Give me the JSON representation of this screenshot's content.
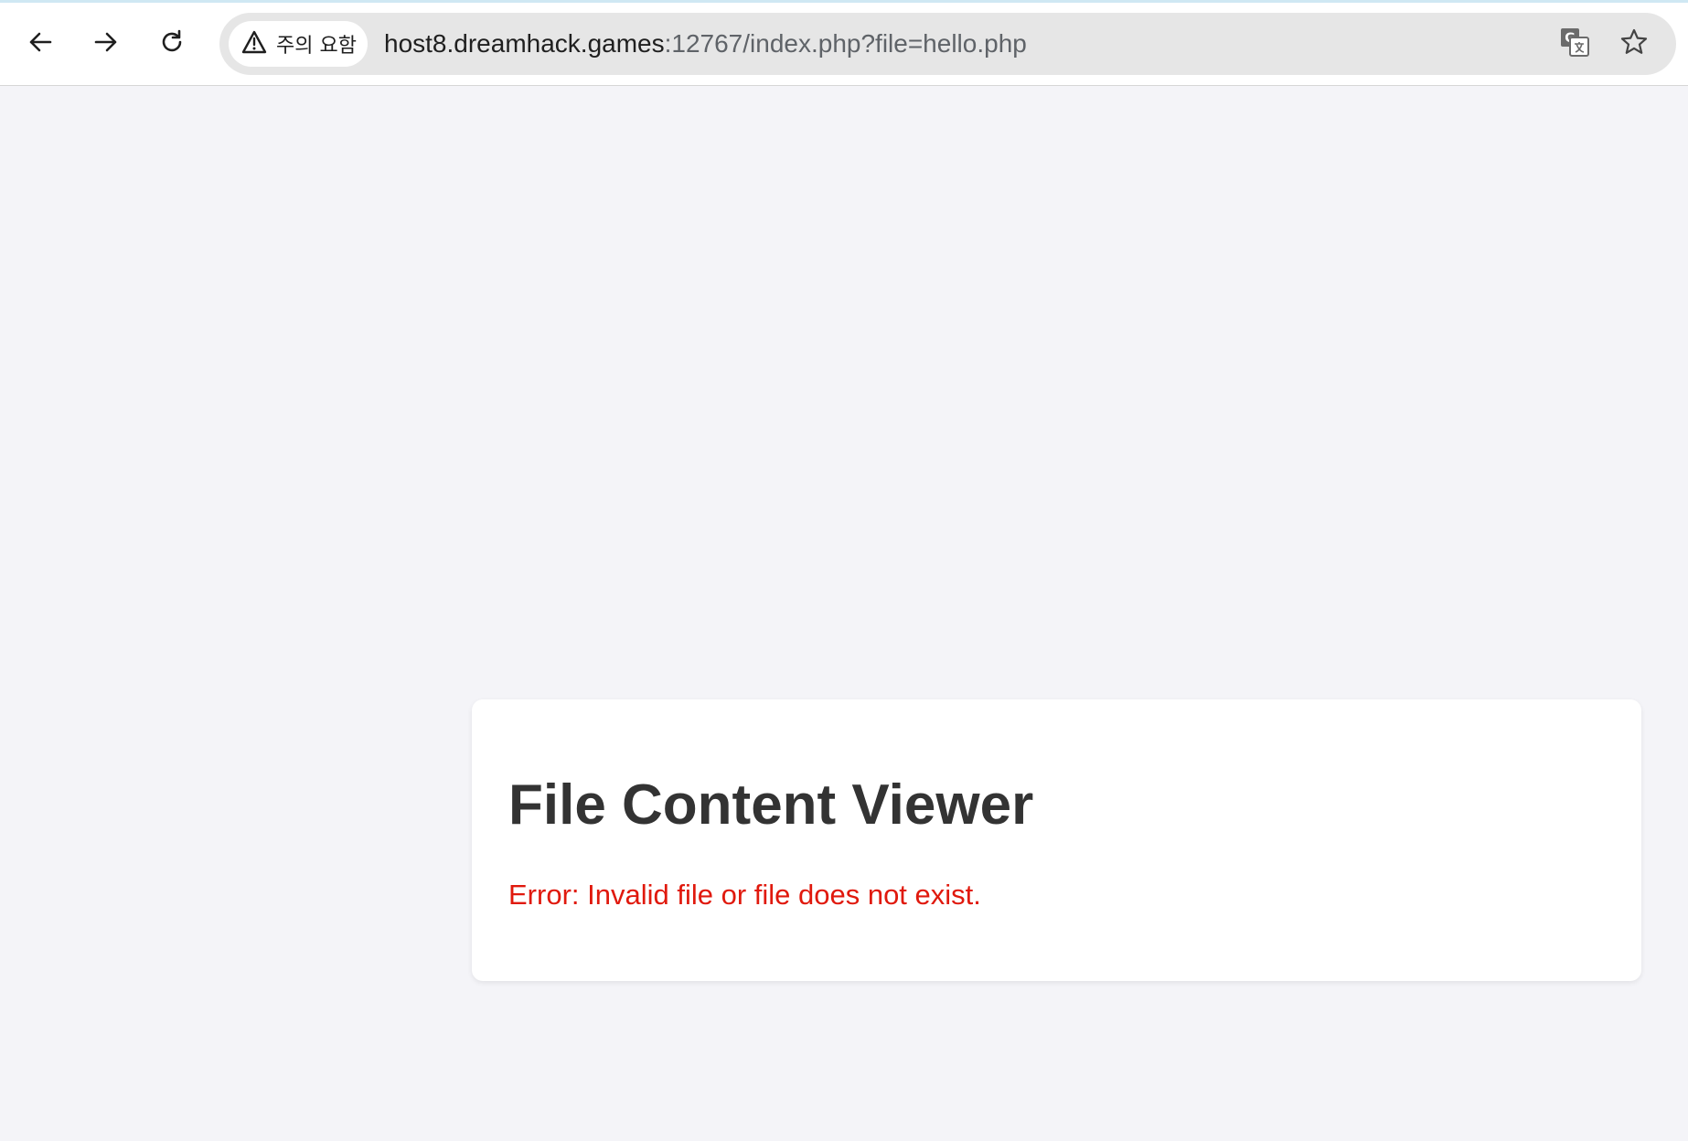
{
  "browser": {
    "security_chip": {
      "label": "주의 요함",
      "icon": "warning-triangle-icon"
    },
    "url": {
      "host": "host8.dreamhack.games",
      "rest": ":12767/index.php?file=hello.php"
    },
    "nav_icons": {
      "back": "back-arrow-icon",
      "forward": "forward-arrow-icon",
      "reload": "reload-icon"
    },
    "omnibox_icons": {
      "translate": "translate-icon",
      "bookmark": "star-icon"
    }
  },
  "page": {
    "title": "File Content Viewer",
    "error_message": "Error: Invalid file or file does not exist."
  },
  "colors": {
    "page_background": "#f4f4f8",
    "card_background": "#ffffff",
    "title": "#333333",
    "error": "#e0190d",
    "omnibox": "#e6e6e6"
  }
}
